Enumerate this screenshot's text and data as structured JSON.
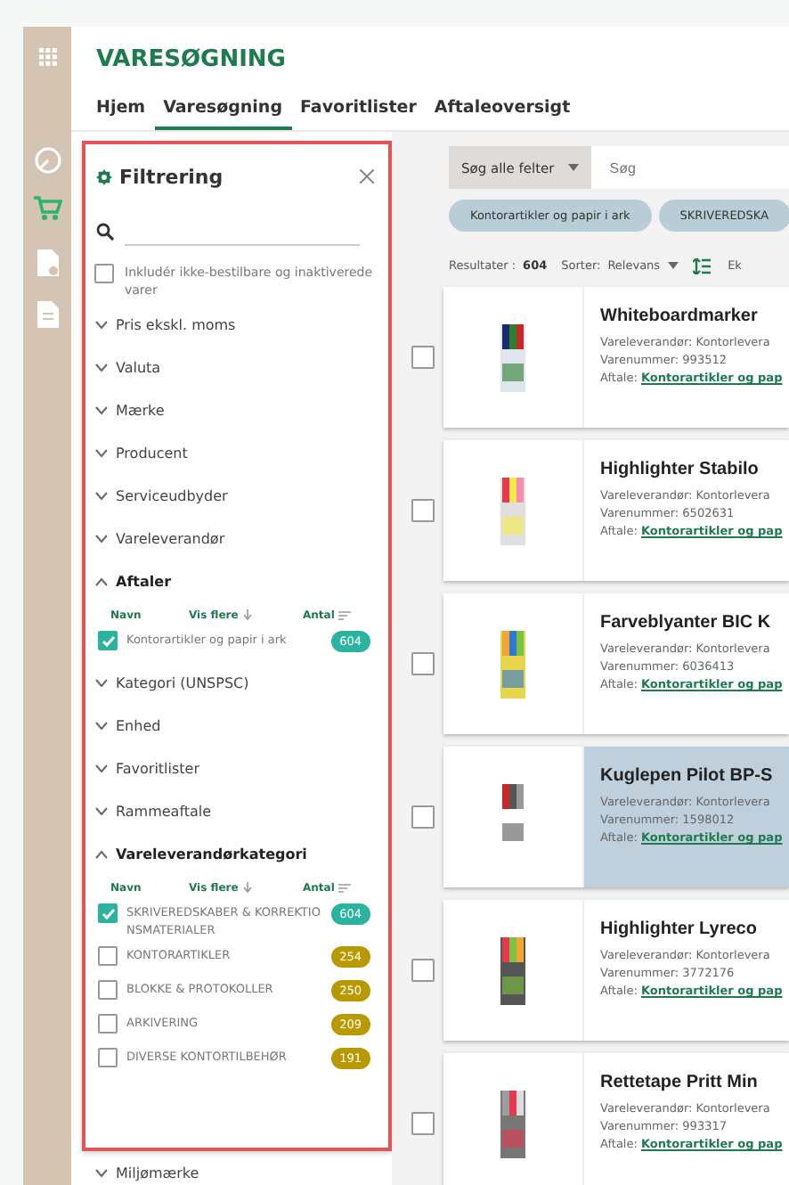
{
  "page_title": "VARESØGNING",
  "tabs": [
    {
      "label": "Hjem",
      "selected": false
    },
    {
      "label": "Varesøgning",
      "selected": true
    },
    {
      "label": "Favoritlister",
      "selected": false
    },
    {
      "label": "Aftaleoversigt",
      "selected": false
    }
  ],
  "filter": {
    "title": "Filtrering",
    "include": {
      "label": "Inkludér ikke-bestilbare og inaktiverede varer",
      "checked": false
    },
    "sections": [
      {
        "label": "Pris ekskl. moms",
        "expanded": false
      },
      {
        "label": "Valuta",
        "expanded": false
      },
      {
        "label": "Mærke",
        "expanded": false
      },
      {
        "label": "Producent",
        "expanded": false
      },
      {
        "label": "Serviceudbyder",
        "expanded": false
      },
      {
        "label": "Vareleverandør",
        "expanded": false
      },
      {
        "label": "Aftaler",
        "expanded": true,
        "columns": [
          "Navn",
          "Vis flere",
          "Antal"
        ],
        "items": [
          {
            "label": "Kontorartikler og papir i ark",
            "count": "604",
            "checked": true,
            "color": "#2bb3a0"
          }
        ]
      },
      {
        "label": "Kategori (UNSPSC)",
        "expanded": false
      },
      {
        "label": "Enhed",
        "expanded": false
      },
      {
        "label": "Favoritlister",
        "expanded": false
      },
      {
        "label": "Rammeaftale",
        "expanded": false
      },
      {
        "label": "Vareleverandørkategori",
        "expanded": true,
        "columns": [
          "Navn",
          "Vis flere",
          "Antal"
        ],
        "items": [
          {
            "label": "SKRIVEREDSKABER & KORREKTIONSMATERIALER",
            "count": "604",
            "checked": true,
            "color": "#2bb3a0"
          },
          {
            "label": "KONTORARTIKLER",
            "count": "254",
            "checked": false,
            "color": "#b89a00"
          },
          {
            "label": "BLOKKE & PROTOKOLLER",
            "count": "250",
            "checked": false,
            "color": "#b89a00"
          },
          {
            "label": "ARKIVERING",
            "count": "209",
            "checked": false,
            "color": "#b89a00"
          },
          {
            "label": "DIVERSE KONTORTILBEHØR",
            "count": "191",
            "checked": false,
            "color": "#b89a00"
          }
        ]
      }
    ]
  },
  "more_sections": [
    {
      "label": "Miljømærke",
      "expanded": false
    }
  ],
  "search": {
    "scope": "Søg alle felter",
    "placeholder": "Søg"
  },
  "chips": [
    "Kontorartikler og papir i ark",
    "SKRIVEREDSKA"
  ],
  "results": {
    "label": "Resultater :",
    "count": "604",
    "sort_label": "Sorter:",
    "sort_value": "Relevans",
    "column_4": "Ek"
  },
  "products": [
    {
      "title": "Whiteboardmarker",
      "supplier": "Vareleverandør: Kontorlevera",
      "number": "Varenummer: 993512",
      "agreement_label": "Aftale:",
      "agreement": "Kontorartikler og pap",
      "selected": false,
      "checked": false
    },
    {
      "title": "Highlighter Stabilo",
      "supplier": "Vareleverandør: Kontorlevera",
      "number": "Varenummer: 6502631",
      "agreement_label": "Aftale:",
      "agreement": "Kontorartikler og pap",
      "selected": false,
      "checked": false
    },
    {
      "title": "Farveblyanter BIC K",
      "supplier": "Vareleverandør: Kontorlevera",
      "number": "Varenummer: 6036413",
      "agreement_label": "Aftale:",
      "agreement": "Kontorartikler og pap",
      "selected": false,
      "checked": false
    },
    {
      "title": "Kuglepen Pilot BP-S",
      "supplier": "Vareleverandør: Kontorlevera",
      "number": "Varenummer: 1598012",
      "agreement_label": "Aftale:",
      "agreement": "Kontorartikler og pap",
      "selected": true,
      "checked": false
    },
    {
      "title": "Highlighter Lyreco",
      "supplier": "Vareleverandør: Kontorlevera",
      "number": "Varenummer: 3772176",
      "agreement_label": "Aftale:",
      "agreement": "Kontorartikler og pap",
      "selected": false,
      "checked": false
    },
    {
      "title": "Rettetape Pritt Min",
      "supplier": "Vareleverandør: Kontorlevera",
      "number": "Varenummer: 993317",
      "agreement_label": "Aftale:",
      "agreement": "Kontorartikler og pap",
      "selected": false,
      "checked": false
    }
  ]
}
